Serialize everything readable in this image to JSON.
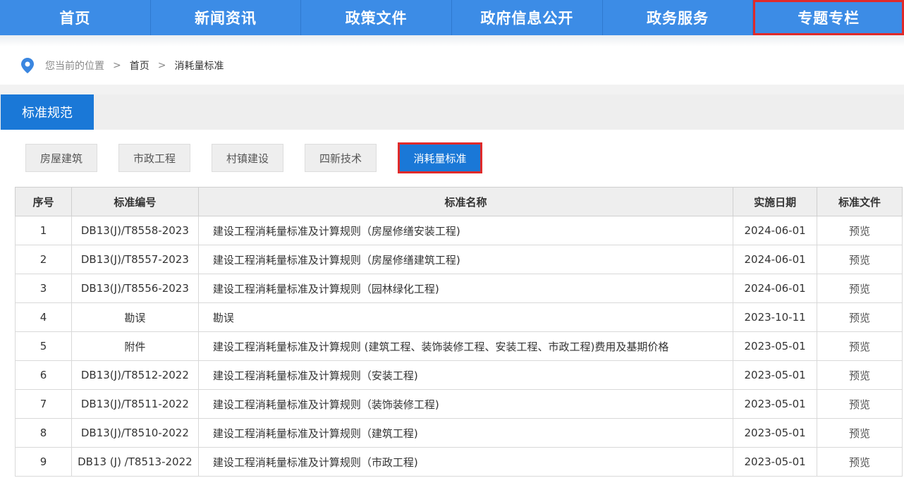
{
  "nav": {
    "items": [
      "首页",
      "新闻资讯",
      "政策文件",
      "政府信息公开",
      "政务服务",
      "专题专栏"
    ]
  },
  "breadcrumb": {
    "prefix": "您当前的位置",
    "sep": ">",
    "home": "首页",
    "current": "消耗量标准"
  },
  "section": {
    "tab": "标准规范"
  },
  "subcategories": [
    "房屋建筑",
    "市政工程",
    "村镇建设",
    "四新技术",
    "消耗量标准"
  ],
  "table": {
    "headers": [
      "序号",
      "标准编号",
      "标准名称",
      "实施日期",
      "标准文件"
    ],
    "rows": [
      {
        "no": "1",
        "code": "DB13(J)/T8558-2023",
        "name": "建设工程消耗量标准及计算规则（房屋修缮安装工程)",
        "date": "2024-06-01",
        "file": "预览"
      },
      {
        "no": "2",
        "code": "DB13(J)/T8557-2023",
        "name": "建设工程消耗量标准及计算规则（房屋修缮建筑工程)",
        "date": "2024-06-01",
        "file": "预览"
      },
      {
        "no": "3",
        "code": "DB13(J)/T8556-2023",
        "name": "建设工程消耗量标准及计算规则（园林绿化工程)",
        "date": "2024-06-01",
        "file": "预览"
      },
      {
        "no": "4",
        "code": "勘误",
        "name": "勘误",
        "date": "2023-10-11",
        "file": "预览"
      },
      {
        "no": "5",
        "code": "附件",
        "name": "建设工程消耗量标准及计算规则 (建筑工程、装饰装修工程、安装工程、市政工程)费用及基期价格",
        "date": "2023-05-01",
        "file": "预览"
      },
      {
        "no": "6",
        "code": "DB13(J)/T8512-2022",
        "name": "建设工程消耗量标准及计算规则（安装工程)",
        "date": "2023-05-01",
        "file": "预览"
      },
      {
        "no": "7",
        "code": "DB13(J)/T8511-2022",
        "name": "建设工程消耗量标准及计算规则（装饰装修工程)",
        "date": "2023-05-01",
        "file": "预览"
      },
      {
        "no": "8",
        "code": "DB13(J)/T8510-2022",
        "name": "建设工程消耗量标准及计算规则（建筑工程)",
        "date": "2023-05-01",
        "file": "预览"
      },
      {
        "no": "9",
        "code": "DB13 (J) /T8513-2022",
        "name": "建设工程消耗量标准及计算规则（市政工程)",
        "date": "2023-05-01",
        "file": "预览"
      }
    ]
  },
  "colors": {
    "nav_bg": "#3c8ce6",
    "accent": "#1a78d7",
    "highlight": "#e02a2a"
  },
  "icons": {
    "breadcrumb": "location-pin-icon"
  }
}
